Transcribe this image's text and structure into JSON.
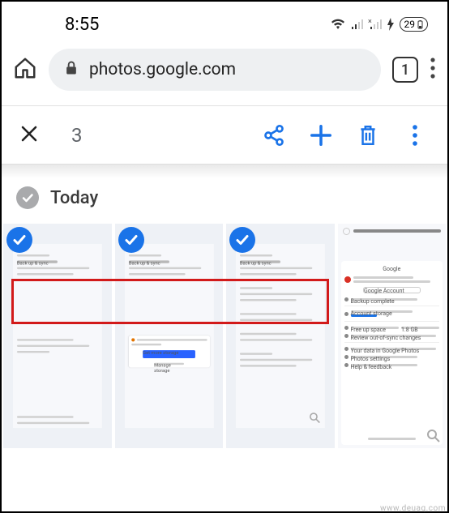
{
  "status": {
    "time": "8:55",
    "battery_pct": "29"
  },
  "browser": {
    "url": "photos.google.com",
    "tab_count": "1"
  },
  "app_bar": {
    "selected_count": "3"
  },
  "section": {
    "title": "Today"
  },
  "photos": [
    {
      "selected": true,
      "alt": "Screenshot: Back up & sync settings page"
    },
    {
      "selected": true,
      "alt": "Screenshot: Storage upgrade prompt with Get more storage button"
    },
    {
      "selected": true,
      "alt": "Screenshot: Back up & sync preferences detail"
    },
    {
      "selected": false,
      "alt": "Screenshot: Google Photos account panel showing backup complete"
    }
  ],
  "mock": {
    "backup_label": "Back up & sync",
    "google_label": "Google",
    "get_storage": "Get more storage",
    "manage": "Manage storage",
    "account": "Google Account",
    "acct_storage": "Account storage",
    "backup_complete": "Backup complete",
    "free_up": "Free up space",
    "review": "Review out-of-sync changes",
    "your_data": "Your data in Google Photos",
    "settings": "Photos settings",
    "help": "Help & feedback",
    "free_size": "1.8 GB"
  },
  "watermark": "www.deuaq.com"
}
